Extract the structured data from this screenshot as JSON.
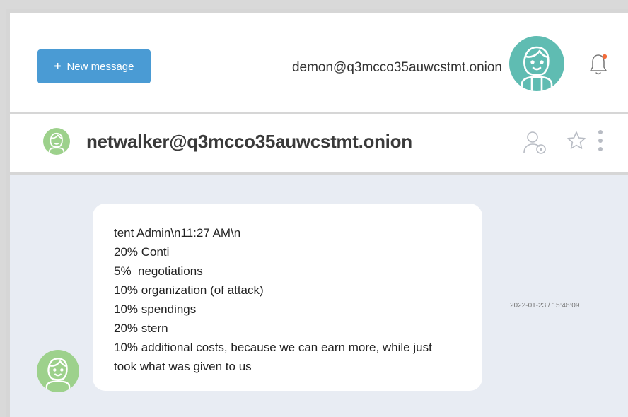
{
  "toolbar": {
    "new_message_label": "New message",
    "plus_glyph": "+",
    "user_email": "demon@q3mcco35auwcstmt.onion",
    "avatar_icon": "user-avatar-icon",
    "bell_icon": "bell-icon",
    "notification_color": "#f26b3a"
  },
  "chat": {
    "contact_name": "netwalker@q3mcco35auwcstmt.onion",
    "icons": [
      "add-contact-icon",
      "star-icon",
      "more-vertical-icon"
    ],
    "messages": [
      {
        "lines": [
          "tent Admin\\n11:27 AM\\n",
          "20% Conti",
          "5%  negotiations",
          "10% organization (of attack)",
          "10% spendings",
          "20% stern",
          "10% additional costs, because we can earn more, while just",
          "took what was given to us"
        ],
        "timestamp": "2022-01-23 / 15:46:09"
      }
    ]
  },
  "colors": {
    "accent": "#4a9bd4",
    "avatar_teal": "#5fbcb2",
    "avatar_green": "#9dd18c",
    "conversation_bg": "#e8ecf3"
  }
}
